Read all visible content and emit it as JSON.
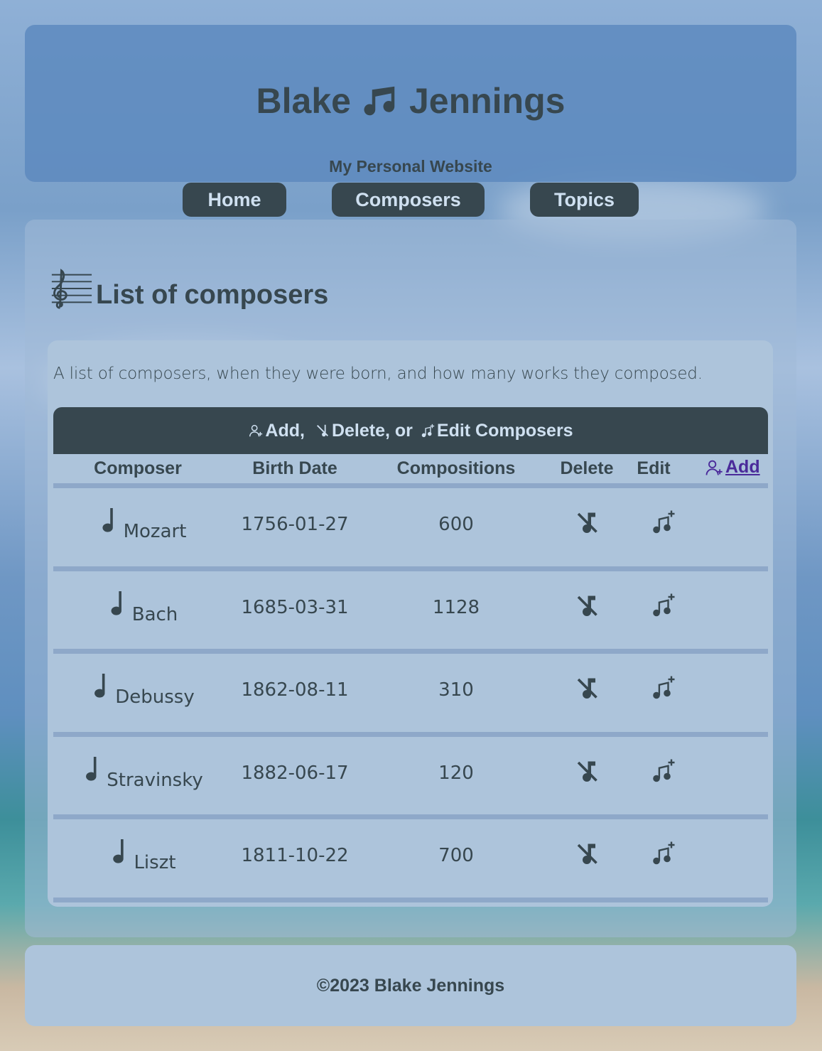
{
  "header": {
    "title_first": "Blake",
    "title_last": "Jennings",
    "subtitle": "My Personal Website"
  },
  "nav": [
    {
      "label": "Home"
    },
    {
      "label": "Composers"
    },
    {
      "label": "Topics"
    }
  ],
  "main": {
    "heading": "List of composers",
    "description": "A list of composers, when they were born, and how many works they composed.",
    "table": {
      "banner_add": "Add,",
      "banner_delete": "Delete, or",
      "banner_edit": "Edit Composers",
      "columns": [
        "Composer",
        "Birth Date",
        "Compositions",
        "Delete",
        "Edit"
      ],
      "add_link": "Add",
      "rows": [
        {
          "name": "Mozart",
          "birth": "1756-01-27",
          "compositions": "600"
        },
        {
          "name": "Bach",
          "birth": "1685-03-31",
          "compositions": "1128"
        },
        {
          "name": "Debussy",
          "birth": "1862-08-11",
          "compositions": "310"
        },
        {
          "name": "Stravinsky",
          "birth": "1882-06-17",
          "compositions": "120"
        },
        {
          "name": "Liszt",
          "birth": "1811-10-22",
          "compositions": "700"
        }
      ]
    }
  },
  "footer": {
    "text": "©2023 Blake Jennings"
  },
  "colors": {
    "dark": "#37474f",
    "link": "#4a2a9a",
    "card": "#adc4db"
  }
}
